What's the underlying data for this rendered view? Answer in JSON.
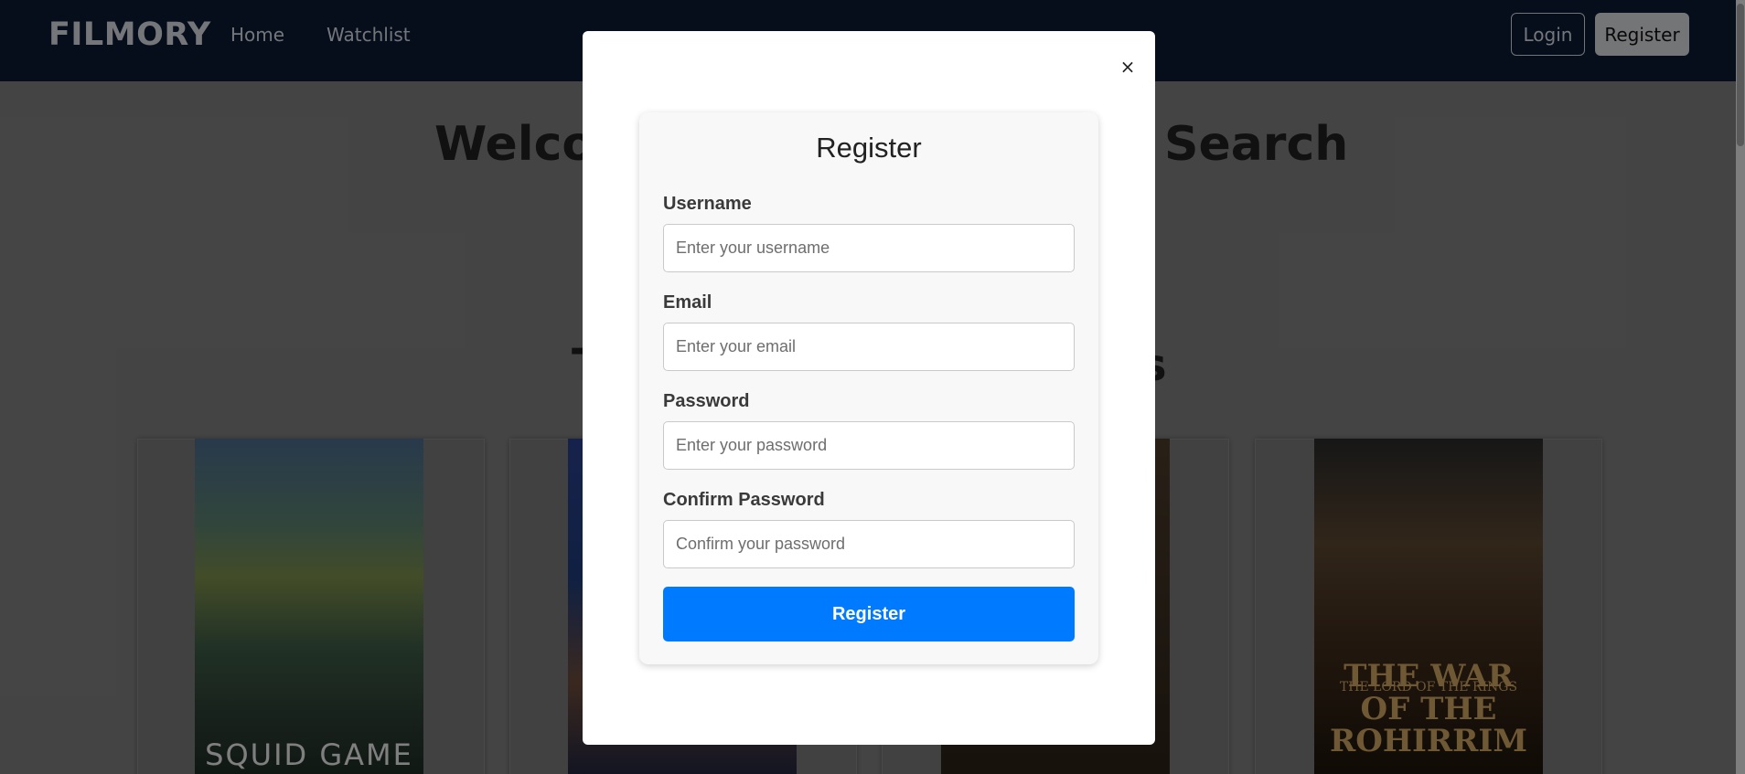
{
  "navbar": {
    "brand": "FILMORY",
    "links": [
      "Home",
      "Watchlist"
    ],
    "login_label": "Login",
    "register_label": "Register"
  },
  "page": {
    "hero_left": "Welcom",
    "hero_right": "Search",
    "section_left": "T",
    "section_right": "s"
  },
  "posters": {
    "squid_game": "SQUID GAME",
    "lotr_line1": "THE LORD OF THE RINGS",
    "lotr_line2": "THE WAR OF THE ROHIRRIM"
  },
  "modal": {
    "close_symbol": "×",
    "title": "Register",
    "username_label": "Username",
    "username_placeholder": "Enter your username",
    "email_label": "Email",
    "email_placeholder": "Enter your email",
    "password_label": "Password",
    "password_placeholder": "Enter your password",
    "confirm_label": "Confirm Password",
    "confirm_placeholder": "Confirm your password",
    "submit_label": "Register"
  },
  "colors": {
    "navbar_bg": "#0b1a33",
    "primary_button": "#007bff",
    "overlay": "#7d7d7d"
  }
}
